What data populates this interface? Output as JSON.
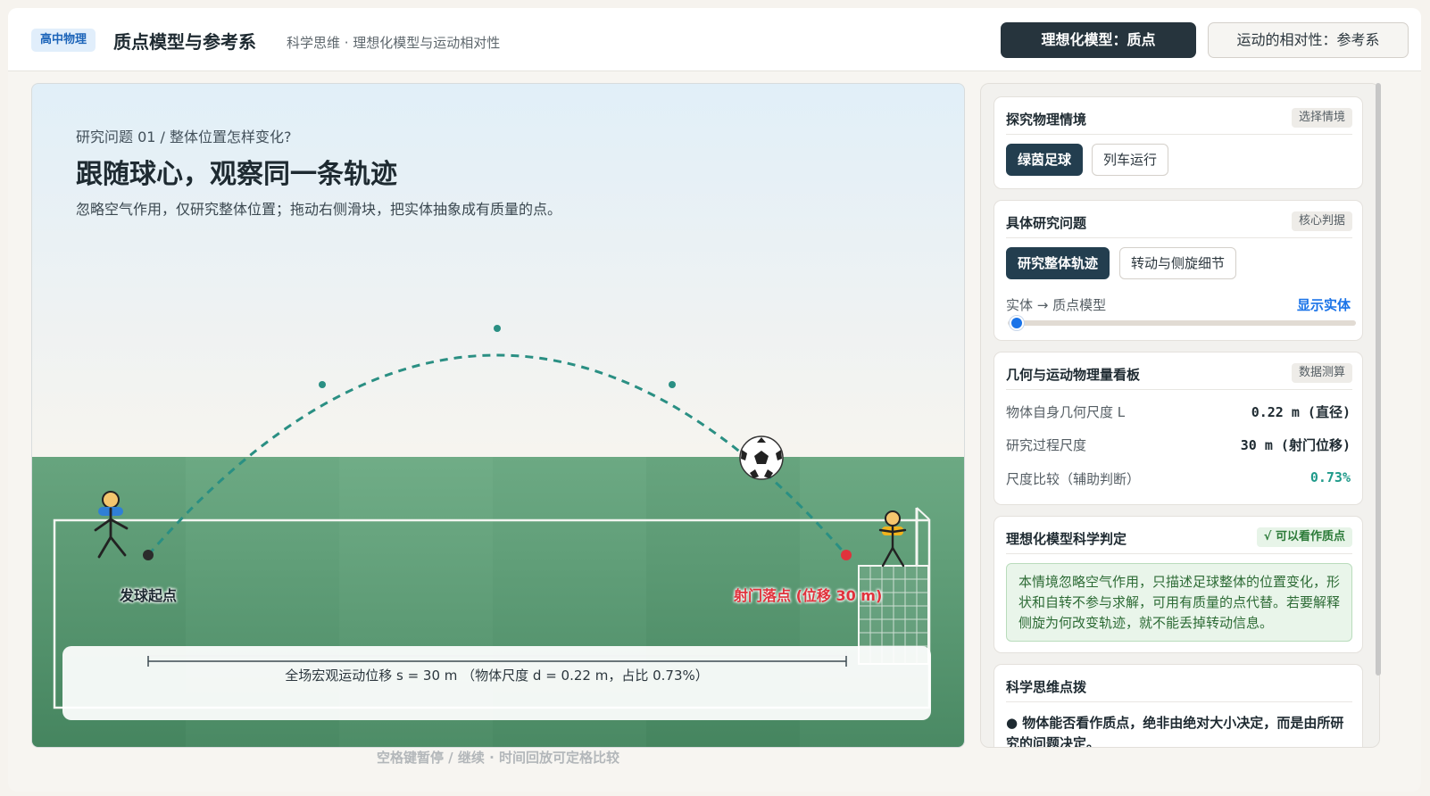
{
  "header": {
    "badge": "高中物理",
    "title": "质点模型与参考系",
    "subtitle": "科学思维 · 理想化模型与运动相对性",
    "mode_tabs": [
      "理想化模型：质点",
      "运动的相对性：参考系"
    ],
    "active_mode": 0
  },
  "stage": {
    "question_label": "研究问题 01 / 整体位置怎样变化?",
    "question_title": "跟随球心，观察同一条轨迹",
    "question_desc": "忽略空气作用，仅研究整体位置；拖动右侧滑块，把实体抽象成有质量的点。",
    "start_label": "发球起点",
    "end_label": "射门落点 (位移 30 m)",
    "measure_text": "全场宏观运动位移 s = 30 m （物体尺度 d = 0.22 m，占比 0.73%）",
    "ball_icon": "⚽",
    "hint": "空格键暂停 / 继续 · 时间回放可定格比较"
  },
  "panel": {
    "context": {
      "title": "探究物理情境",
      "tag": "选择情境",
      "options": [
        "绿茵足球",
        "列车运行"
      ],
      "active": 0
    },
    "question": {
      "title": "具体研究问题",
      "tag": "核心判据",
      "options": [
        "研究整体轨迹",
        "转动与侧旋细节"
      ],
      "active": 0,
      "slider_label": "实体 → 质点模型",
      "slider_link": "显示实体",
      "slider_value": 0
    },
    "dashboard": {
      "title": "几何与运动物理量看板",
      "tag": "数据测算",
      "rows": [
        {
          "label": "物体自身几何尺度 L",
          "value": "0.22 m (直径)"
        },
        {
          "label": "研究过程尺度",
          "value": "30 m (射门位移)"
        },
        {
          "label": "尺度比较（辅助判断）",
          "value": "0.73%"
        }
      ]
    },
    "verdict": {
      "title": "理想化模型科学判定",
      "tag": "√ 可以看作质点",
      "text": "本情境忽略空气作用，只描述足球整体的位置变化，形状和自转不参与求解，可用有质量的点代替。若要解释侧旋为何改变轨迹，就不能丢掉转动信息。"
    },
    "tips": {
      "title": "科学思维点拨",
      "text": "● 物体能否看作质点，绝非由绝对大小决定，而是由所研究的问题决定。"
    }
  },
  "colors": {
    "trajectory": "#2a8f83",
    "start_point": "#2b2b2b",
    "end_point": "#e0323c",
    "grass": "#5e9e75",
    "accent_blue": "#1a73e8"
  }
}
